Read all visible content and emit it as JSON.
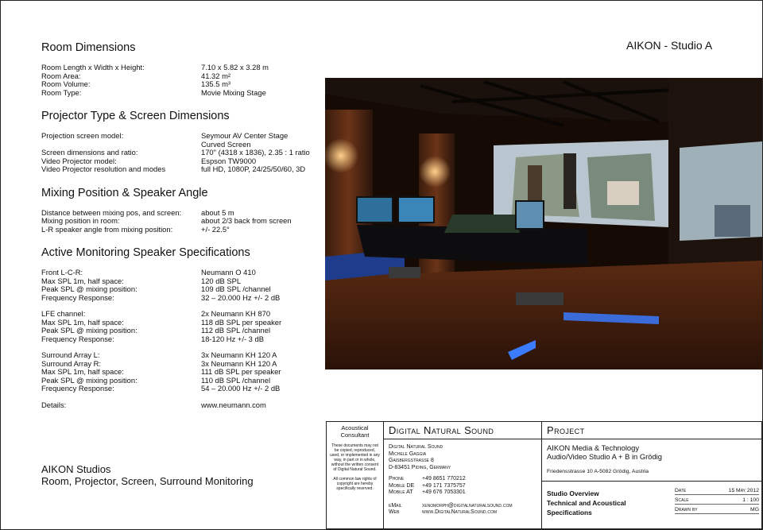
{
  "header": {
    "studio_title": "AIKON - Studio A"
  },
  "sections": {
    "room": {
      "title": "Room Dimensions",
      "rows": [
        {
          "label": "Room Length x Width x Height:",
          "value": "7.10 x 5.82 x 3.28 m"
        },
        {
          "label": "Room Area:",
          "value": "41.32 m²"
        },
        {
          "label": "Room Volume:",
          "value": "135.5 m³"
        },
        {
          "label": "Room Type:",
          "value": "Movie Mixing Stage"
        }
      ]
    },
    "projector": {
      "title": "Projector Type & Screen Dimensions",
      "rows": [
        {
          "label": "Projection screen model:",
          "value": "Seymour AV Center Stage"
        },
        {
          "label": "",
          "value": "Curved Screen"
        },
        {
          "label": "Screen dimensions and ratio:",
          "value": "170\" (4318 x 1836), 2.35 : 1 ratio"
        },
        {
          "label": "Video Projector model:",
          "value": "Espson TW9000"
        },
        {
          "label": "Video Projector resolution and modes",
          "value": "full HD, 1080P, 24/25/50/60, 3D"
        }
      ]
    },
    "mixing": {
      "title": "Mixing Position & Speaker Angle",
      "rows": [
        {
          "label": "Distance between mixing pos, and screen:",
          "value": "about 5 m"
        },
        {
          "label": "Mixing position in room:",
          "value": "about 2/3 back from screen"
        },
        {
          "label": "L-R speaker angle from mixing position:",
          "value": "+/- 22.5°"
        }
      ]
    },
    "monitoring": {
      "title": "Active Monitoring Speaker Specifications",
      "front": [
        {
          "label": "Front L-C-R:",
          "value": "Neumann O 410"
        },
        {
          "label": "Max SPL 1m, half space:",
          "value": "120 dB SPL"
        },
        {
          "label": "Peak SPL @ mixing position:",
          "value": "109 dB SPL /channel"
        },
        {
          "label": "Frequency Response:",
          "value": "32 – 20.000 Hz +/- 2 dB"
        }
      ],
      "lfe": [
        {
          "label": "LFE channel:",
          "value": "2x Neumann KH 870"
        },
        {
          "label": "Max SPL 1m, half space:",
          "value": "118 dB SPL per speaker"
        },
        {
          "label": "Peak SPL @ mixing position:",
          "value": "112 dB SPL /channel"
        },
        {
          "label": "Frequency Response:",
          "value": "18-120 Hz +/- 3 dB"
        }
      ],
      "surround": [
        {
          "label": "Surround Array L:",
          "value": "3x Neumann KH 120 A"
        },
        {
          "label": "Surround Array R:",
          "value": "3x Neumann KH 120 A"
        },
        {
          "label": "Max SPL 1m, half space:",
          "value": "111 dB SPL per speaker"
        },
        {
          "label": "Peak SPL @ mixing position:",
          "value": "110 dB SPL /channel"
        },
        {
          "label": "Frequency Response:",
          "value": "54 – 20.000 Hz +/- 2 dB"
        }
      ],
      "details": {
        "label": "Details:",
        "value": "www.neumann.com"
      }
    }
  },
  "footer": {
    "line1": "AIKON Studios",
    "line2": "Room, Projector, Screen, Surround Monitoring"
  },
  "title_block": {
    "consultant": {
      "heading1": "Acoustical",
      "heading2": "Consultant",
      "notice1": "These documents may not be copied, reproduced, used, or implemented in any way, in part or in whole, without the written consent of Digital Natural Sound.",
      "notice2": "All common law rights of copyright are hereby specifically reserved."
    },
    "firm": {
      "name": "Digital Natural Sound",
      "address": [
        "Digital Natural Sound",
        "Michele Gaggia",
        "Gaisbergstrasse 8",
        "D-83451 Piding, Germany"
      ],
      "phones": [
        {
          "label": "Phone",
          "value": "+49 8651 770212"
        },
        {
          "label": "Mobile DE",
          "value": "+49 171 7375757"
        },
        {
          "label": "Mobile AT",
          "value": "+49 676 7053301"
        }
      ],
      "web": [
        {
          "label": "eMail",
          "value": "xenomorph@digitalnaturalsound.com"
        },
        {
          "label": "Web",
          "value": "www.DigitalNaturalSound.com"
        }
      ]
    },
    "project": {
      "heading": "Project",
      "client1": "AIKON Media & Technology",
      "client2": "Audio/Video Studio A + B in Grödig",
      "place": "Friedensstrasse 10 A-5082 Grödig,  Austria",
      "doc1": "Studio Overview",
      "doc2": "Technical and Acoustical",
      "doc3": "Specifications",
      "meta": [
        {
          "label": "Date",
          "value": "15 May 2012"
        },
        {
          "label": "Scale",
          "value": "1 : 100"
        },
        {
          "label": "Drawn by",
          "value": "MG"
        }
      ]
    }
  }
}
